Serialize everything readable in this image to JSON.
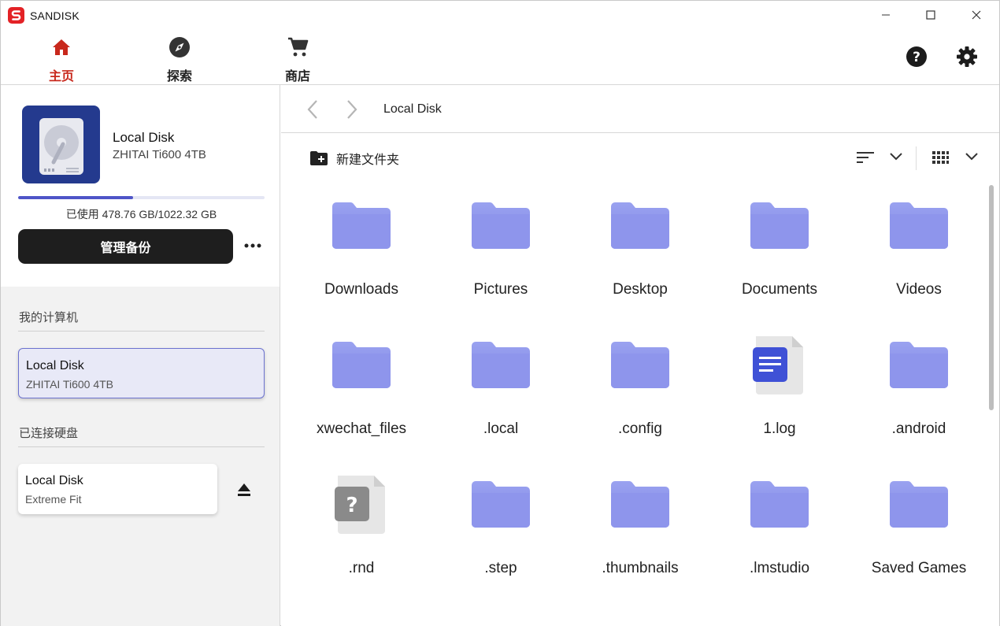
{
  "app": {
    "title": "SANDISK"
  },
  "nav": {
    "items": [
      {
        "label": "主页",
        "icon": "home-icon"
      },
      {
        "label": "探索",
        "icon": "compass-icon"
      },
      {
        "label": "商店",
        "icon": "cart-icon"
      }
    ]
  },
  "drive": {
    "name": "Local Disk",
    "model": "ZHITAI Ti600 4TB",
    "usage_text": "已使用 478.76 GB/1022.32 GB",
    "usage_fraction": 0.468,
    "manage_label": "管理备份"
  },
  "sections": {
    "my_computer": "我的计算机",
    "connected": "已连接硬盘"
  },
  "computer_disks": [
    {
      "name": "Local Disk",
      "sub": "ZHITAI Ti600 4TB"
    }
  ],
  "connected_disks": [
    {
      "name": "Local Disk",
      "sub": "Extreme Fit"
    }
  ],
  "breadcrumb": "Local Disk",
  "toolbar": {
    "new_folder": "新建文件夹"
  },
  "items": [
    {
      "name": "Downloads",
      "type": "folder"
    },
    {
      "name": "Pictures",
      "type": "folder"
    },
    {
      "name": "Desktop",
      "type": "folder"
    },
    {
      "name": "Documents",
      "type": "folder"
    },
    {
      "name": "Videos",
      "type": "folder"
    },
    {
      "name": "xwechat_files",
      "type": "folder"
    },
    {
      "name": ".local",
      "type": "folder"
    },
    {
      "name": ".config",
      "type": "folder"
    },
    {
      "name": "1.log",
      "type": "text-file"
    },
    {
      "name": ".android",
      "type": "folder"
    },
    {
      "name": ".rnd",
      "type": "unknown-file"
    },
    {
      "name": ".step",
      "type": "folder"
    },
    {
      "name": ".thumbnails",
      "type": "folder"
    },
    {
      "name": ".lmstudio",
      "type": "folder"
    },
    {
      "name": "Saved Games",
      "type": "folder"
    }
  ],
  "colors": {
    "accent": "#c8281c",
    "folder": "#8c93ea",
    "usage": "#4f55c8",
    "selected_bg": "#e8e9f7"
  }
}
